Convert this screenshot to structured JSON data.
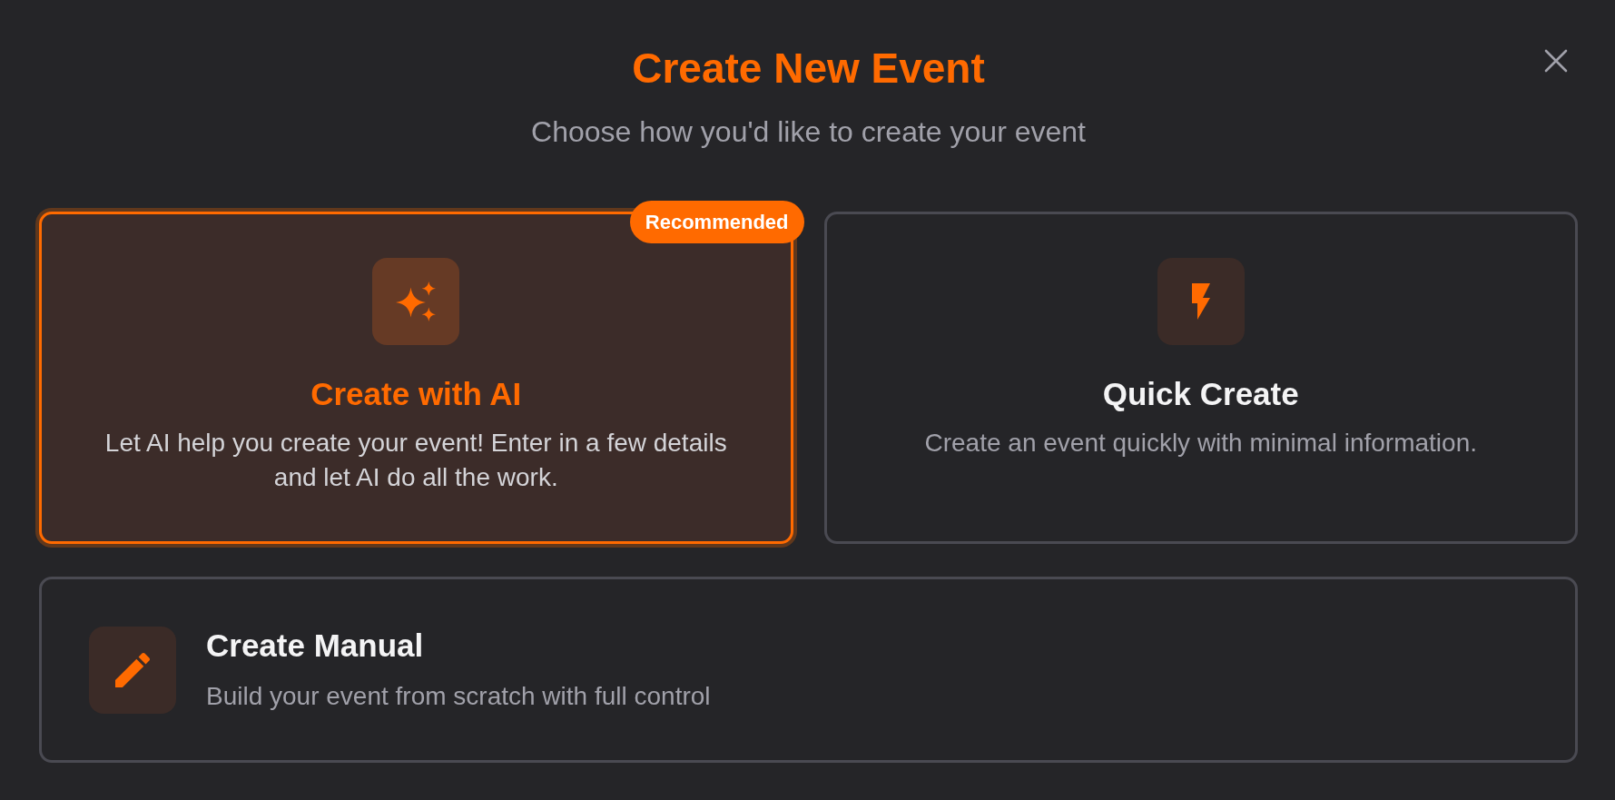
{
  "dialog": {
    "title": "Create New Event",
    "subtitle": "Choose how you'd like to create your event"
  },
  "options": [
    {
      "kind": "ai",
      "title": "Create with AI",
      "description": "Let AI help you create your event! Enter in a few details and let AI do all the work.",
      "badge": "Recommended",
      "selected": true
    },
    {
      "kind": "quick",
      "title": "Quick Create",
      "description": "Create an event quickly with minimal information.",
      "selected": false
    },
    {
      "kind": "manual",
      "title": "Create Manual",
      "description": "Build your event from scratch with full control",
      "selected": false
    }
  ]
}
